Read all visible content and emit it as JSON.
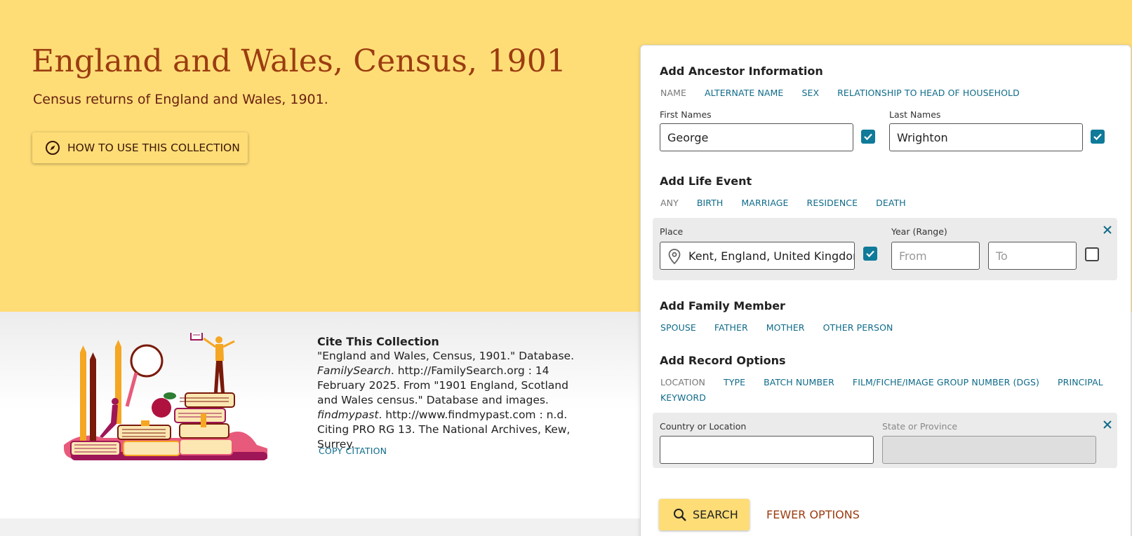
{
  "hero": {
    "title": "England and Wales, Census, 1901",
    "subtitle": "Census returns of England and Wales, 1901.",
    "howto_label": "HOW TO USE THIS COLLECTION"
  },
  "citation": {
    "heading": "Cite This Collection",
    "part1": "\"England and Wales, Census, 1901.\" Database. ",
    "italic1": "FamilySearch",
    "part2": ". http://FamilySearch.org : 14 February 2025. From \"1901 England, Scotland and Wales census.\" Database and images. ",
    "italic2": "findmypast",
    "part3": ". http://www.findmypast.com : n.d. Citing PRO RG 13. The National Archives, Kew, Surrey.",
    "copy_label": "COPY CITATION"
  },
  "ancestor": {
    "heading": "Add Ancestor Information",
    "tabs": [
      "NAME",
      "ALTERNATE NAME",
      "SEX",
      "RELATIONSHIP TO HEAD OF HOUSEHOLD"
    ],
    "first_label": "First Names",
    "first_value": "George",
    "last_label": "Last Names",
    "last_value": "Wrighton"
  },
  "life_event": {
    "heading": "Add Life Event",
    "tabs": [
      "ANY",
      "BIRTH",
      "MARRIAGE",
      "RESIDENCE",
      "DEATH"
    ],
    "place_label": "Place",
    "place_value": "Kent, England, United Kingdom",
    "year_label": "Year (Range)",
    "from_placeholder": "From",
    "to_placeholder": "To"
  },
  "family": {
    "heading": "Add Family Member",
    "tabs": [
      "SPOUSE",
      "FATHER",
      "MOTHER",
      "OTHER PERSON"
    ]
  },
  "record_options": {
    "heading": "Add Record Options",
    "tabs": [
      "LOCATION",
      "TYPE",
      "BATCH NUMBER",
      "FILM/FICHE/IMAGE GROUP NUMBER (DGS)",
      "PRINCIPAL"
    ],
    "tab_row2": "KEYWORD",
    "country_label": "Country or Location",
    "country_value": "",
    "state_label": "State or Province"
  },
  "actions": {
    "search_label": "SEARCH",
    "fewer_label": "FEWER OPTIONS"
  },
  "colors": {
    "hero_bg": "#fedd77",
    "title_brown": "#9b3c10",
    "link_teal": "#0f6b8a",
    "checkbox_teal": "#0f7a99"
  }
}
